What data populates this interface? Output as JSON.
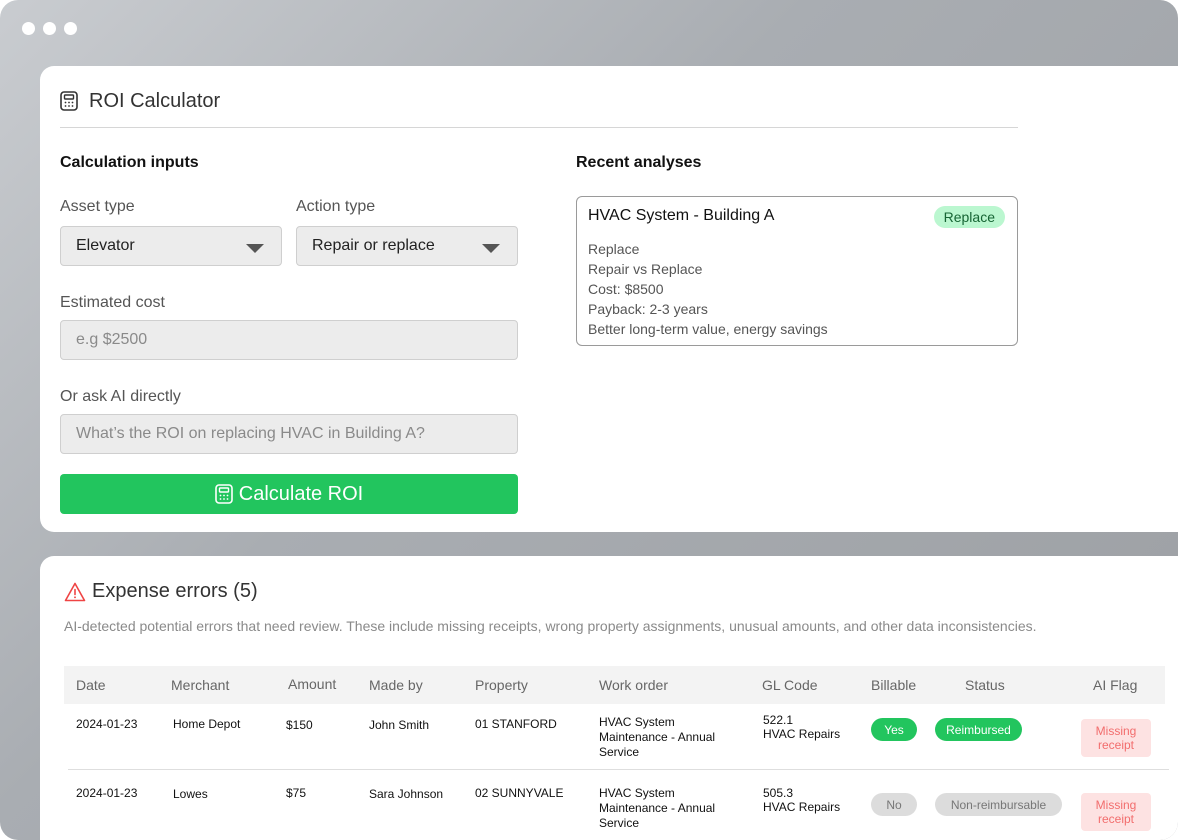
{
  "roi": {
    "title": "ROI Calculator",
    "inputs_title": "Calculation inputs",
    "asset_type_label": "Asset type",
    "asset_type_value": "Elevator",
    "action_type_label": "Action type",
    "action_type_value": "Repair or replace",
    "estimated_cost_label": "Estimated cost",
    "estimated_cost_placeholder": "e.g $2500",
    "ask_ai_label": "Or ask AI directly",
    "ask_ai_placeholder": "What’s the ROI on replacing HVAC in Building A?",
    "calculate_label": "Calculate ROI",
    "recent_title": "Recent analyses",
    "analysis": {
      "title": "HVAC System - Building A",
      "badge": "Replace",
      "lines": [
        "Replace",
        "Repair vs Replace",
        "Cost: $8500",
        "Payback: 2-3 years",
        "Better long-term value, energy savings"
      ]
    }
  },
  "expenses": {
    "title": "Expense errors (5)",
    "description": "AI-detected potential errors that need review. These include missing receipts, wrong property assignments, unusual amounts, and other data inconsistencies.",
    "columns": [
      "Date",
      "Merchant",
      "Amount",
      "Made by",
      "Property",
      "Work order",
      "GL Code",
      "Billable",
      "Status",
      "AI Flag"
    ],
    "rows": [
      {
        "date": "2024-01-23",
        "merchant": "Home Depot",
        "amount": "$150",
        "made_by": "John Smith",
        "property": "01 STANFORD",
        "work_order": "HVAC System Maintenance - Annual Service",
        "gl_code": "522.1",
        "gl_name": "HVAC Repairs",
        "billable": "Yes",
        "status": "Reimbursed",
        "ai_flag": "Missing receipt"
      },
      {
        "date": "2024-01-23",
        "merchant": "Lowes",
        "amount": "$75",
        "made_by": "Sara Johnson",
        "property": "02 SUNNYVALE",
        "work_order": "HVAC System Maintenance - Annual Service",
        "gl_code": "505.3",
        "gl_name": "HVAC Repairs",
        "billable": "No",
        "status": "Non-reimbursable",
        "ai_flag": "Missing receipt"
      }
    ]
  },
  "colors": {
    "accent_green": "#22c55e",
    "badge_green": "#bbf7d0",
    "flag_red": "#fde2e2"
  },
  "icons": {
    "title_icon": "calculator-icon",
    "warning_icon": "warning-triangle-icon"
  }
}
